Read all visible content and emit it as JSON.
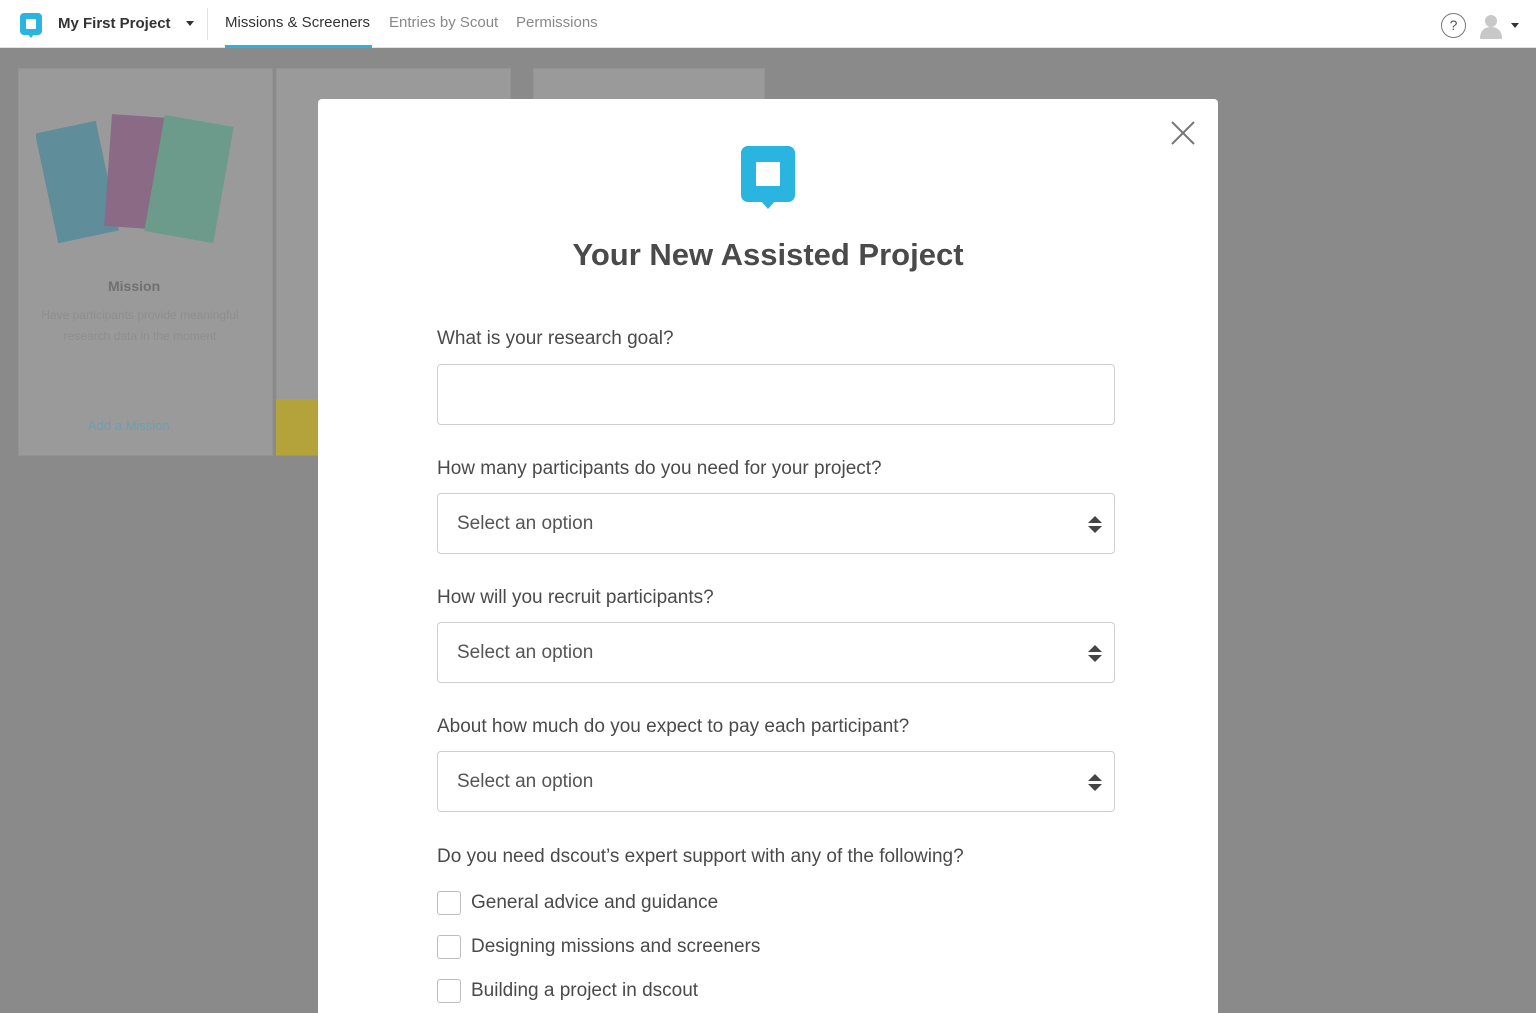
{
  "topbar": {
    "project_name": "My First Project",
    "tabs": [
      {
        "label": "Missions & Screeners",
        "active": true
      },
      {
        "label": "Entries by Scout",
        "active": false
      },
      {
        "label": "Permissions",
        "active": false
      }
    ],
    "help_label": "?"
  },
  "background": {
    "card_title": "Mission",
    "card_desc": "Have participants provide meaningful research data in the moment",
    "card_link": "Add a Mission"
  },
  "modal": {
    "title": "Your New Assisted Project",
    "goal": {
      "label": "What is your research goal?",
      "value": "",
      "placeholder": ""
    },
    "participants": {
      "label": "How many participants do you need for your project?",
      "selected": "Select an option"
    },
    "recruit": {
      "label": "How will you recruit participants?",
      "selected": "Select an option"
    },
    "pay": {
      "label": "About how much do you expect to pay each participant?",
      "selected": "Select an option"
    },
    "support": {
      "label": "Do you need dscout’s expert support with any of the following?",
      "options": [
        {
          "label": "General advice and guidance",
          "checked": false
        },
        {
          "label": "Designing missions and screeners",
          "checked": false
        },
        {
          "label": "Building a project in dscout",
          "checked": false
        }
      ]
    }
  },
  "colors": {
    "accent": "#2ab4e0",
    "overlay": "#8a8a8a"
  }
}
